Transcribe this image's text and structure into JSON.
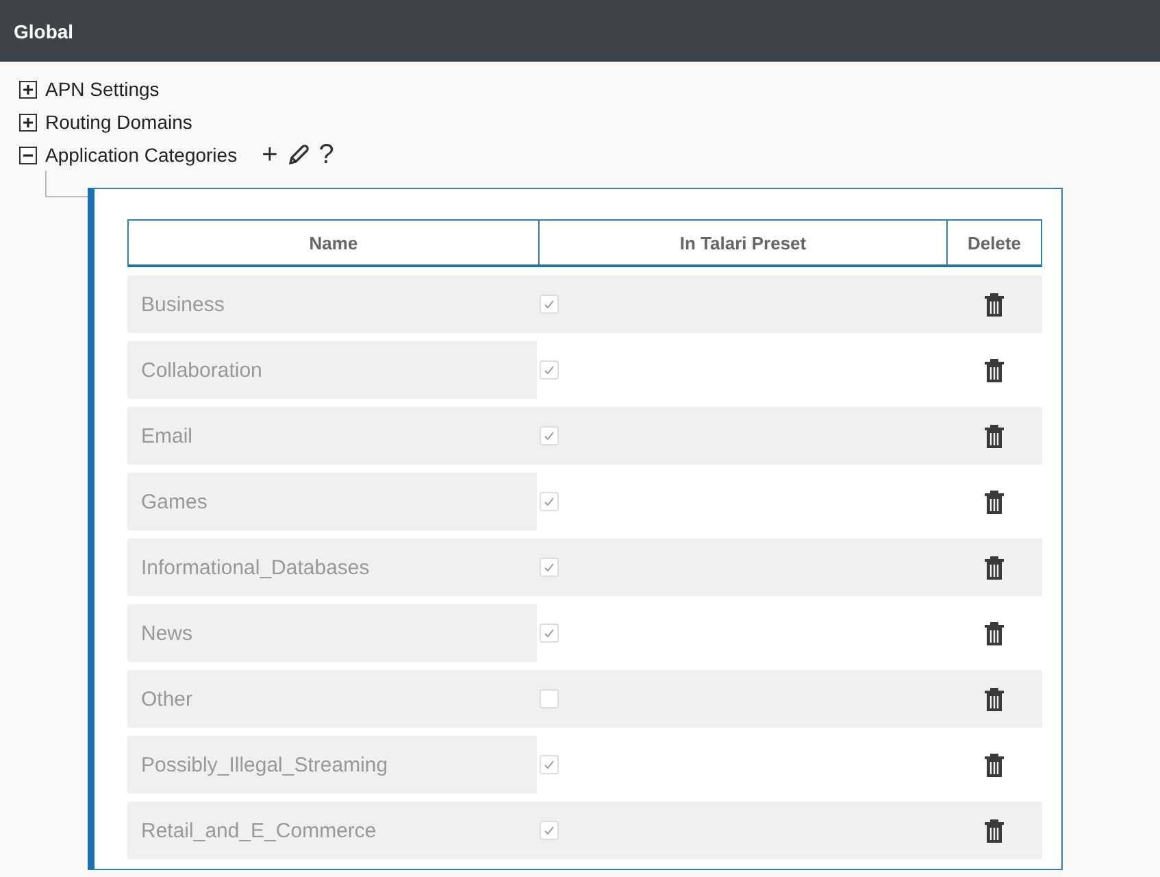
{
  "header": {
    "title": "Global"
  },
  "tree": [
    {
      "label": "APN Settings",
      "expanded": false
    },
    {
      "label": "Routing Domains",
      "expanded": false
    },
    {
      "label": "Application Categories",
      "expanded": true,
      "actions": [
        "+",
        "?"
      ]
    }
  ],
  "table": {
    "columns": [
      "Name",
      "In Talari Preset",
      "Delete"
    ],
    "rows": [
      {
        "name": "Business",
        "checked": true
      },
      {
        "name": "Collaboration",
        "checked": true
      },
      {
        "name": "Email",
        "checked": true
      },
      {
        "name": "Games",
        "checked": true
      },
      {
        "name": "Informational_Databases",
        "checked": true
      },
      {
        "name": "News",
        "checked": true
      },
      {
        "name": "Other",
        "checked": false
      },
      {
        "name": "Possibly_Illegal_Streaming",
        "checked": true
      },
      {
        "name": "Retail_and_E_Commerce",
        "checked": true
      }
    ]
  }
}
